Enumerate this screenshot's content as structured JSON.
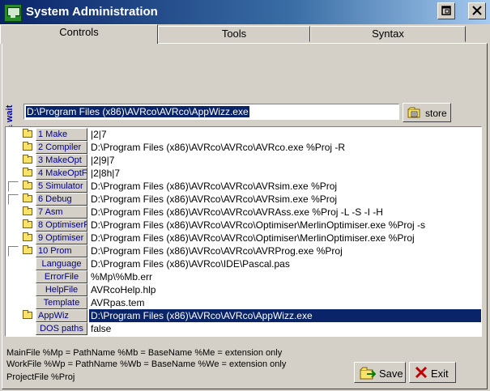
{
  "window": {
    "title": "System Administration"
  },
  "tabs": [
    {
      "label": "Controls"
    },
    {
      "label": "Tools"
    },
    {
      "label": "Syntax"
    }
  ],
  "exec_wait_label": "<Exec & wait",
  "path_input": {
    "value": "D:\\Program Files (x86)\\AVRco\\AVRco\\AppWizz.exe"
  },
  "store_label": "store",
  "rows": [
    {
      "checkbox": false,
      "folder": true,
      "label": "1 Make",
      "value": "|2|7"
    },
    {
      "checkbox": false,
      "folder": true,
      "label": "2 Compiler",
      "value": "D:\\Program Files (x86)\\AVRco\\AVRco\\AVRco.exe %Proj -R"
    },
    {
      "checkbox": false,
      "folder": true,
      "label": "3 MakeOpt",
      "value": "|2|9|7"
    },
    {
      "checkbox": false,
      "folder": true,
      "label": "4 MakeOptF",
      "value": "|2|8h|7"
    },
    {
      "checkbox": true,
      "folder": true,
      "label": "5 Simulator",
      "value": "D:\\Program Files (x86)\\AVRco\\AVRco\\AVRsim.exe %Proj"
    },
    {
      "checkbox": true,
      "folder": true,
      "label": "6 Debug",
      "value": "D:\\Program Files (x86)\\AVRco\\AVRco\\AVRsim.exe %Proj"
    },
    {
      "checkbox": false,
      "folder": true,
      "label": "7 Asm",
      "value": "D:\\Program Files (x86)\\AVRco\\AVRco\\AVRAss.exe %Proj -L -S -I -H"
    },
    {
      "checkbox": false,
      "folder": true,
      "label": "8 OptimiserF",
      "value": "D:\\Program Files (x86)\\AVRco\\AVRco\\Optimiser\\MerlinOptimiser.exe %Proj -s"
    },
    {
      "checkbox": false,
      "folder": true,
      "label": "9 Optimiser",
      "value": "D:\\Program Files (x86)\\AVRco\\AVRco\\Optimiser\\MerlinOptimiser.exe %Proj"
    },
    {
      "checkbox": true,
      "folder": true,
      "label": "10 Prom",
      "value": "D:\\Program Files (x86)\\AVRco\\AVRco\\AVRProg.exe %Proj"
    },
    {
      "checkbox": false,
      "folder": false,
      "label": "Language",
      "value": "D:\\Program Files (x86)\\AVRco\\IDE\\Pascal.pas"
    },
    {
      "checkbox": false,
      "folder": false,
      "label": "ErrorFile",
      "value": "%Mp\\%Mb.err"
    },
    {
      "checkbox": false,
      "folder": false,
      "label": "HelpFile",
      "value": "AVRcoHelp.hlp"
    },
    {
      "checkbox": false,
      "folder": false,
      "label": "Template",
      "value": "AVRpas.tem"
    },
    {
      "checkbox": false,
      "folder": true,
      "label": "AppWiz",
      "value": "D:\\Program Files (x86)\\AVRco\\AVRco\\AppWizz.exe",
      "selected": true
    },
    {
      "checkbox": false,
      "folder": false,
      "label": "DOS paths",
      "value": "false"
    }
  ],
  "info_lines": [
    "MainFile %Mp = PathName  %Mb = BaseName  %Me = extension only",
    "WorkFile %Wp = PathName  %Wb = BaseName  %We = extension only",
    "ProjectFile %Proj"
  ],
  "buttons": {
    "save": "Save",
    "exit": "Exit"
  },
  "colors": {
    "selection": "#0a246a",
    "label_text": "#000080",
    "vertical_label": "#0000c0"
  }
}
